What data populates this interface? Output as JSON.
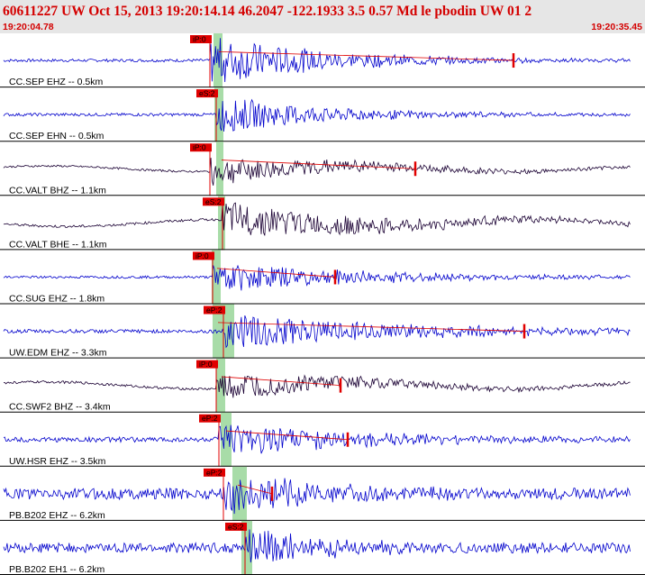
{
  "header": {
    "title": "60611227 UW Oct 15, 2013 19:20:14.14   46.2047 -122.1933  3.5 0.57 Md le pbodin UW 01   2",
    "start_time": "19:20:04.78",
    "end_time": "19:20:35.45"
  },
  "colors": {
    "header_bg": "#e6e6e6",
    "header_text": "#d40000",
    "trace_blue": "#0000cc",
    "trace_dark": "#1a0033",
    "pick_red": "#e00000",
    "window_green": "#a8dca8",
    "separator": "#000000"
  },
  "channels": [
    {
      "label": "CC.SEP EHZ -- 0.5km",
      "pick": "iP:0",
      "color": "blue",
      "noise": 0.12,
      "burst": 1.0,
      "burst_end": 0.45,
      "coda": true,
      "end_marker": true
    },
    {
      "label": "CC.SEP EHN -- 0.5km",
      "pick": "eS:2",
      "color": "blue",
      "noise": 0.12,
      "burst": 0.75,
      "burst_end": 0.42,
      "coda": false,
      "end_marker": false
    },
    {
      "label": "CC.VALT BHZ -- 1.1km",
      "pick": "iP:0",
      "color": "dark",
      "noise": 0.08,
      "burst": 0.55,
      "burst_end": 0.75,
      "coda": true,
      "end_marker": true
    },
    {
      "label": "CC.VALT BHE -- 1.1km",
      "pick": "eS:2",
      "color": "dark",
      "noise": 0.1,
      "burst": 0.7,
      "burst_end": 0.9,
      "coda": false,
      "end_marker": false
    },
    {
      "label": "CC.SUG EHZ -- 1.8km",
      "pick": "iP:0",
      "color": "blue",
      "noise": 0.1,
      "burst": 0.6,
      "burst_end": 0.75,
      "coda": true,
      "end_marker": true
    },
    {
      "label": "UW.EDM EHZ -- 3.3km",
      "pick": "eP:2",
      "color": "blue",
      "noise": 0.15,
      "burst": 0.7,
      "burst_end": 1.0,
      "coda": true,
      "end_marker": true
    },
    {
      "label": "CC.SWF2 BHZ -- 3.4km",
      "pick": "iP:0",
      "color": "dark",
      "noise": 0.1,
      "burst": 0.6,
      "burst_end": 0.65,
      "coda": true,
      "end_marker": true
    },
    {
      "label": "UW.HSR EHZ -- 3.5km",
      "pick": "eP:2",
      "color": "blue",
      "noise": 0.2,
      "burst": 0.7,
      "burst_end": 0.6,
      "coda": true,
      "end_marker": true
    },
    {
      "label": "PB.B202 EHZ -- 6.2km",
      "pick": "eP:2",
      "color": "blue",
      "noise": 0.45,
      "burst": 0.8,
      "burst_end": 0.35,
      "coda": true,
      "end_marker": true
    },
    {
      "label": "PB.B202 EH1 -- 6.2km",
      "pick": "eS:2",
      "color": "blue",
      "noise": 0.4,
      "burst": 0.8,
      "burst_end": 0.2,
      "coda": false,
      "end_marker": false
    }
  ]
}
